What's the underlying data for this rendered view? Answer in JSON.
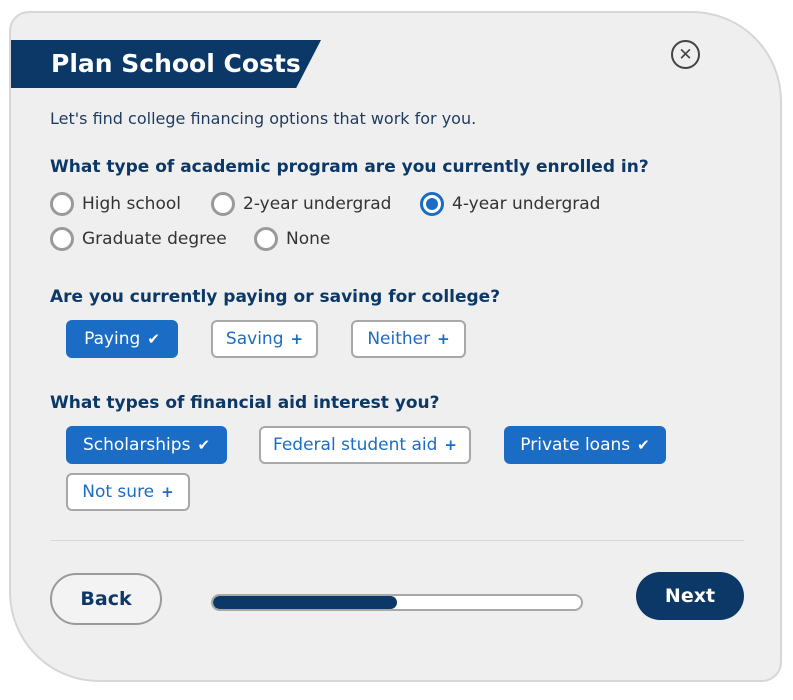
{
  "header": {
    "title": "Plan School Costs",
    "close_icon": "close-circle-icon"
  },
  "intro": "Let's find college financing options that work for you.",
  "q1": {
    "question": "What type of academic program are you currently enrolled in?",
    "options": [
      {
        "label": "High school",
        "selected": false
      },
      {
        "label": "2-year undergrad",
        "selected": false
      },
      {
        "label": "4-year undergrad",
        "selected": true
      },
      {
        "label": "Graduate degree",
        "selected": false
      },
      {
        "label": "None",
        "selected": false
      }
    ]
  },
  "q2": {
    "question": "Are you currently paying or saving for college?",
    "chips": [
      {
        "label": "Paying",
        "selected": true
      },
      {
        "label": "Saving",
        "selected": false
      },
      {
        "label": "Neither",
        "selected": false
      }
    ]
  },
  "q3": {
    "question": "What types of financial aid interest you?",
    "chips": [
      {
        "label": "Scholarships",
        "selected": true
      },
      {
        "label": "Federal student aid",
        "selected": false
      },
      {
        "label": "Private loans",
        "selected": true
      },
      {
        "label": "Not sure",
        "selected": false
      }
    ]
  },
  "footer": {
    "back_label": "Back",
    "next_label": "Next",
    "progress": 0.5
  },
  "colors": {
    "primary_navy": "#0b3866",
    "accent_blue": "#1b6cc4",
    "card_bg": "#efefef"
  }
}
